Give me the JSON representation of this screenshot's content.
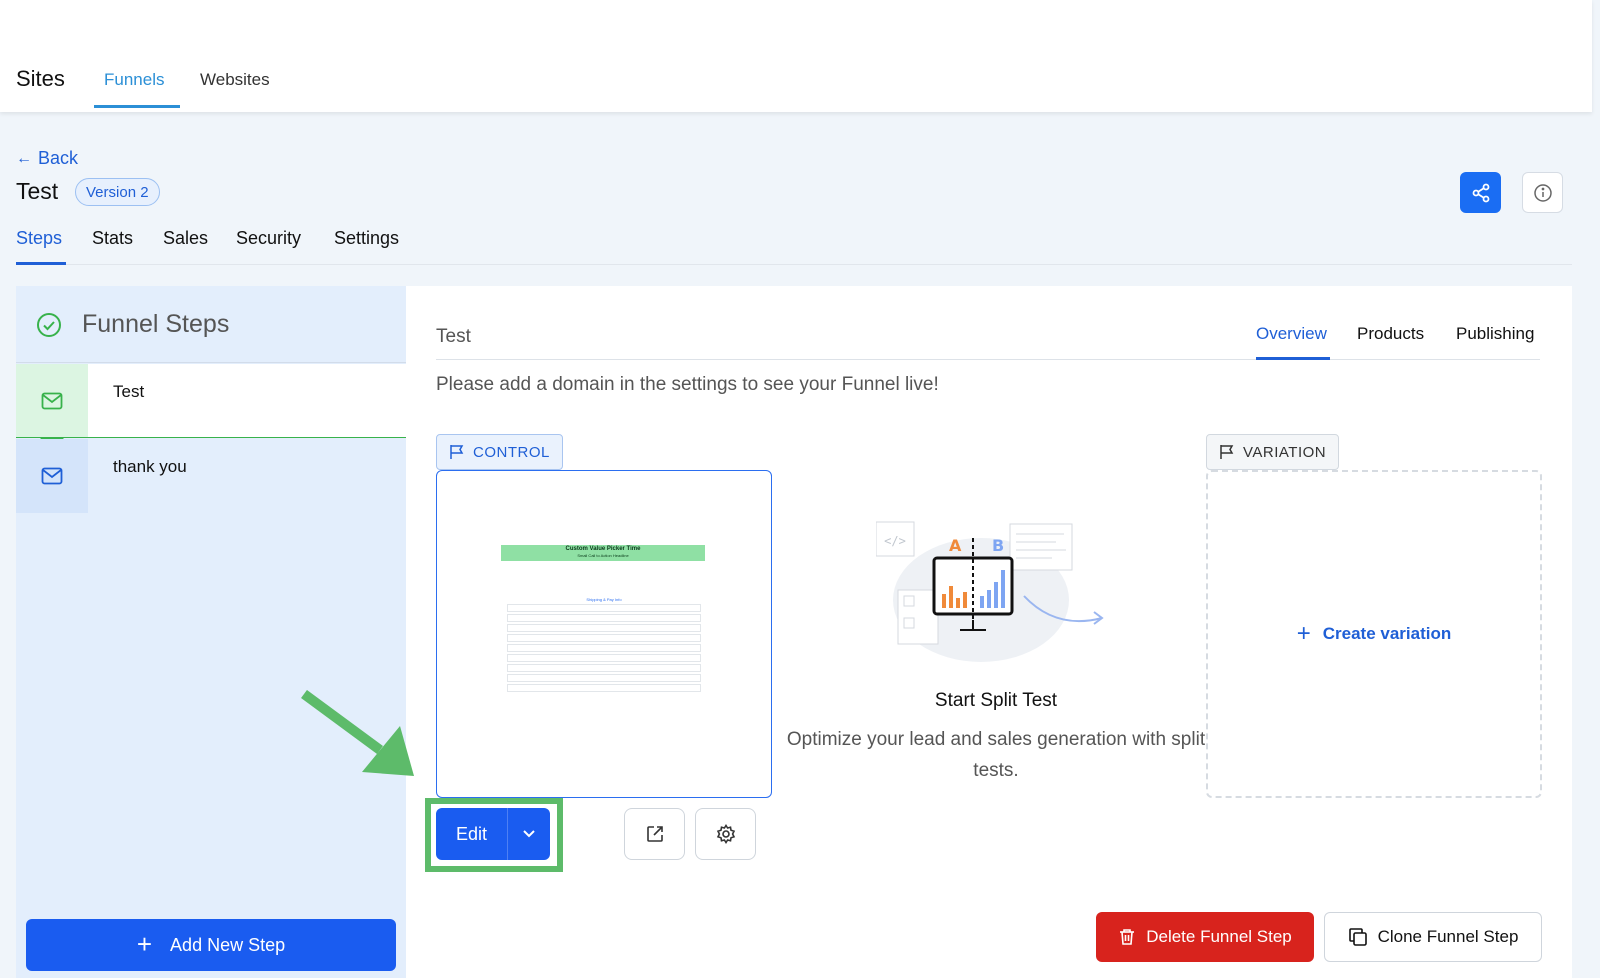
{
  "header": {
    "app_title": "Sites",
    "tabs": [
      {
        "label": "Funnels",
        "active": true
      },
      {
        "label": "Websites",
        "active": false
      }
    ]
  },
  "page": {
    "back_label": "Back",
    "title": "Test",
    "version_badge": "Version 2",
    "tabs": [
      {
        "label": "Steps",
        "active": true
      },
      {
        "label": "Stats",
        "active": false
      },
      {
        "label": "Sales",
        "active": false
      },
      {
        "label": "Security",
        "active": false
      },
      {
        "label": "Settings",
        "active": false
      }
    ]
  },
  "sidebar": {
    "title": "Funnel Steps",
    "steps": [
      {
        "label": "Test",
        "icon": "mail-icon",
        "active": true
      },
      {
        "label": "thank you",
        "icon": "mail-icon",
        "active": false
      }
    ],
    "add_button_label": "Add New Step"
  },
  "main": {
    "title": "Test",
    "tabs": [
      {
        "label": "Overview",
        "active": true
      },
      {
        "label": "Products",
        "active": false
      },
      {
        "label": "Publishing",
        "active": false
      }
    ],
    "notice": "Please add a domain in the settings to see your Funnel live!",
    "control_tag": "CONTROL",
    "variation_tag": "VARIATION",
    "create_variation_label": "Create variation",
    "split_test": {
      "title": "Start Split Test",
      "description": "Optimize your lead and sales generation with split tests.",
      "label_a": "A",
      "label_b": "B"
    },
    "edit_label": "Edit",
    "delete_label": "Delete Funnel Step",
    "clone_label": "Clone Funnel Step",
    "preview": {
      "heading": "Custom Value Picker Time",
      "subheading": "Small Call to Action Headline",
      "form_title": "Shipping & Pay Info"
    }
  },
  "colors": {
    "primary": "#1a5cf0",
    "link": "#1f5fd6",
    "danger": "#d8231d",
    "success": "#38b24b",
    "highlight": "#5dbb6a"
  }
}
